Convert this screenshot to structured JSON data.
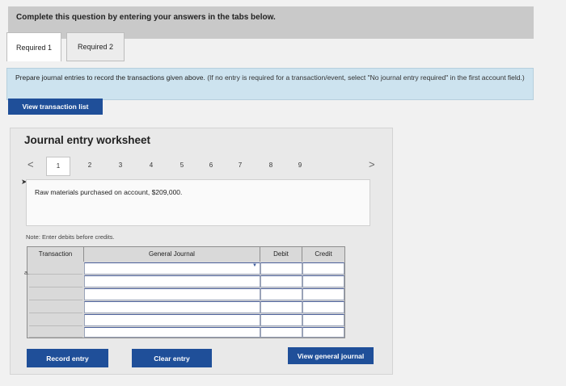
{
  "banner": {
    "text": "Complete this question by entering your answers in the tabs below."
  },
  "tabs": [
    {
      "label": "Required 1",
      "active": true
    },
    {
      "label": "Required 2",
      "active": false
    }
  ],
  "prompt": {
    "text": "Prepare journal entries to record the transactions given above.",
    "note": "(If no entry is required for a transaction/event, select \"No journal entry required\" in the first account field.)"
  },
  "buttons": {
    "view_transaction_list": "View transaction list",
    "record_entry": "Record entry",
    "clear_entry": "Clear entry",
    "view_general_journal": "View general journal"
  },
  "worksheet": {
    "title": "Journal entry worksheet",
    "nav_prev": "<",
    "nav_next": ">",
    "pages": [
      "1",
      "2",
      "3",
      "4",
      "5",
      "6",
      "7",
      "8",
      "9"
    ],
    "active_page": "1",
    "description": "Raw materials purchased on account, $209,000.",
    "note": "Note: Enter debits before credits."
  },
  "table": {
    "headers": {
      "transaction": "Transaction",
      "general_journal": "General Journal",
      "debit": "Debit",
      "credit": "Credit"
    },
    "first_transaction": "a."
  },
  "colors": {
    "button_blue": "#1f4f99",
    "prompt_bg": "#cde3ef",
    "banner_bg": "#c9c9c9"
  }
}
